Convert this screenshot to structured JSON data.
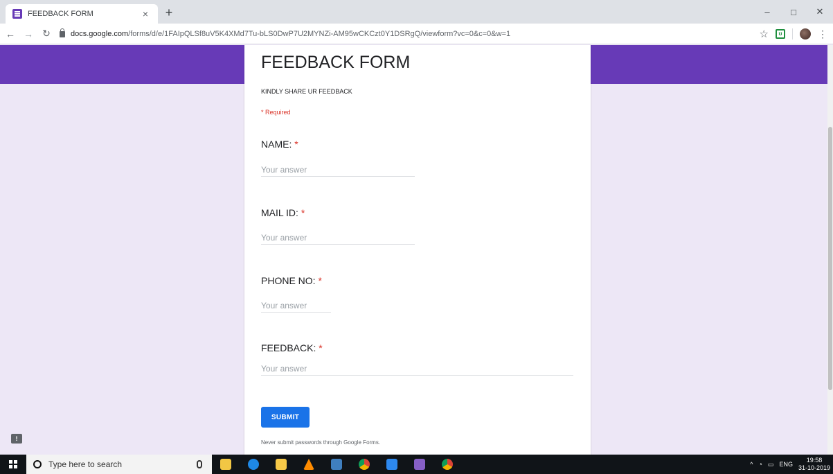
{
  "browser": {
    "tab_title": "FEEDBACK FORM",
    "tab_close": "×",
    "new_tab": "+",
    "url_host": "docs.google.com",
    "url_path": "/forms/d/e/1FAIpQLSf8uV5K4XMd7Tu-bLS0DwP7U2MYNZi-AM95wCKCzt0Y1DSRgQ/viewform?vc=0&c=0&w=1",
    "window_controls": [
      "–",
      "□",
      "✕"
    ]
  },
  "form": {
    "title": "FEEDBACK FORM",
    "description": "KINDLY SHARE UR FEEDBACK",
    "required_note": "* Required",
    "questions": [
      {
        "label": "NAME:",
        "placeholder": "Your answer"
      },
      {
        "label": "MAIL ID:",
        "placeholder": "Your answer"
      },
      {
        "label": "PHONE NO:",
        "placeholder": "Your answer"
      },
      {
        "label": "FEEDBACK:",
        "placeholder": "Your answer"
      }
    ],
    "required_star": "*",
    "submit_label": "SUBMIT",
    "footer": "Never submit passwords through Google Forms."
  },
  "taskbar": {
    "search_placeholder": "Type here to search",
    "language": "ENG",
    "time": "19:58",
    "date": "31-10-2019"
  },
  "colors": {
    "accent": "#673ab7",
    "submit": "#1a73e8",
    "required": "#d93025"
  }
}
